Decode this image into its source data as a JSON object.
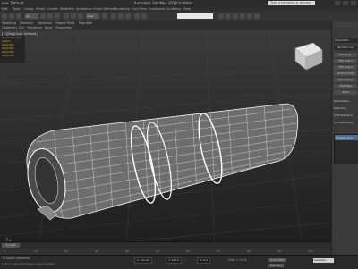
{
  "app": {
    "title": "Autodesk 3ds Max 2016    Untitled",
    "workspace": "ace: Default",
    "search_placeholder": "Type a keyword or phrase"
  },
  "menu": [
    "Edit",
    "Tools",
    "Group",
    "Views",
    "Create",
    "Modifiers",
    "Animation",
    "Graph Editors",
    "Rendering",
    "Civil View",
    "Customize",
    "Scripting",
    "Help"
  ],
  "toolbar": {
    "selection_filter": "All",
    "view_mode": "View"
  },
  "ribbon": {
    "tabs": [
      "Modeling",
      "Freeform",
      "Selection",
      "Object Paint",
      "Populate"
    ],
    "sub_tabs": [
      "Geometry (All)",
      "Transform",
      "Align",
      "Properties"
    ]
  },
  "viewport": {
    "label": "[+] [Perspective] [Shaded + Edged Faces]",
    "label_short": "[+][Top][User Defined]"
  },
  "left_panel": {
    "items": [
      "Geometry (All)",
      "object",
      "Object01",
      "Object02",
      "Object03",
      "Object04"
    ]
  },
  "command_panel": {
    "object_name": "Object001",
    "modifier_list": "Modifier List",
    "buttons": [
      "Edit Poly",
      "FFD 3x3x3",
      "FFD 4x4x4",
      "Turbosmooth",
      "Symmetry",
      "UVW Map",
      "Shell"
    ],
    "section_labels": [
      "Parameters",
      "Selection",
      "Soft Selection",
      "Edit Geometry"
    ],
    "list_header": "Editable Poly"
  },
  "timeline": {
    "frame": "0 / 100",
    "ticks": [
      "0",
      "10",
      "20",
      "30",
      "40",
      "50",
      "60",
      "70",
      "80",
      "90",
      "100"
    ]
  },
  "status": {
    "selected": "1 Object Selected",
    "hint": "Click or click-and-drag to select objects",
    "x": "X: -54.24",
    "y": "Y: 121.5",
    "z": "Z: 0.0",
    "grid": "Grid = 10.0",
    "autokey": "Auto Key",
    "selected_field": "Selected",
    "set_key": "Set Key"
  }
}
